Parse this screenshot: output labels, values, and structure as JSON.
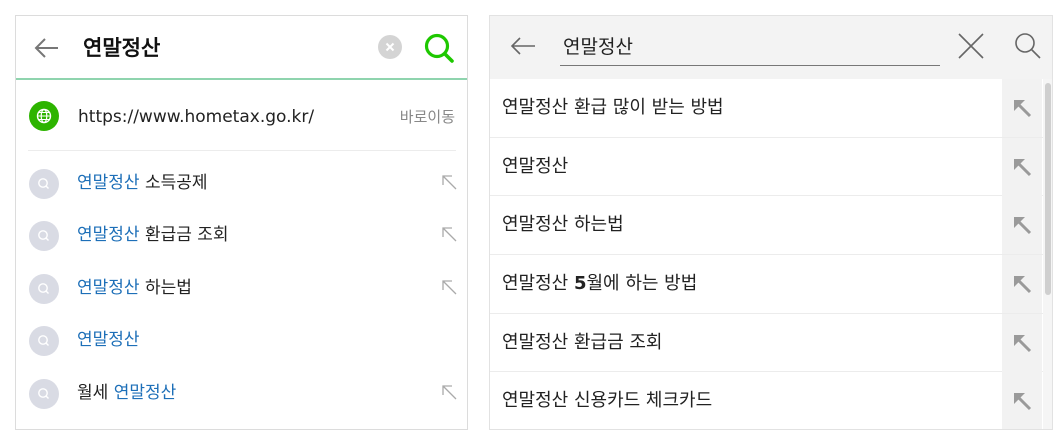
{
  "left": {
    "query": "연말정산",
    "url_suggestion": {
      "url": "https://www.hometax.go.kr/",
      "action": "바로이동"
    },
    "suggestions": [
      {
        "before": "",
        "highlight": "연말정산",
        "after": " 소득공제",
        "arrow": true
      },
      {
        "before": "",
        "highlight": "연말정산",
        "after": " 환급금 조회",
        "arrow": true
      },
      {
        "before": "",
        "highlight": "연말정산",
        "after": " 하는법",
        "arrow": true
      },
      {
        "before": "",
        "highlight": "연말정산",
        "after": "",
        "arrow": false
      },
      {
        "before": "월세 ",
        "highlight": "연말정산",
        "after": "",
        "arrow": true
      }
    ],
    "colors": {
      "accent": "#2db400",
      "highlight": "#1d6fb8",
      "underline": "#8fd4ae"
    }
  },
  "right": {
    "query": "연말정산",
    "suggestions": [
      {
        "prefix": "연말정산 환급 많이 받는 방법",
        "bold": "",
        "suffix": ""
      },
      {
        "prefix": "연말정산",
        "bold": "",
        "suffix": ""
      },
      {
        "prefix": "연말정산 하는법",
        "bold": "",
        "suffix": ""
      },
      {
        "prefix": "연말정산 ",
        "bold": "5",
        "suffix": "월에 하는 방법"
      },
      {
        "prefix": "연말정산 환급금 조회",
        "bold": "",
        "suffix": ""
      },
      {
        "prefix": "연말정산 신용카드 체크카드",
        "bold": "",
        "suffix": ""
      }
    ]
  },
  "icons": {
    "back": "back-arrow-icon",
    "clear": "clear-icon",
    "search": "search-icon",
    "globe": "globe-icon",
    "fill_query": "fill-query-arrow-icon",
    "close": "close-icon"
  }
}
